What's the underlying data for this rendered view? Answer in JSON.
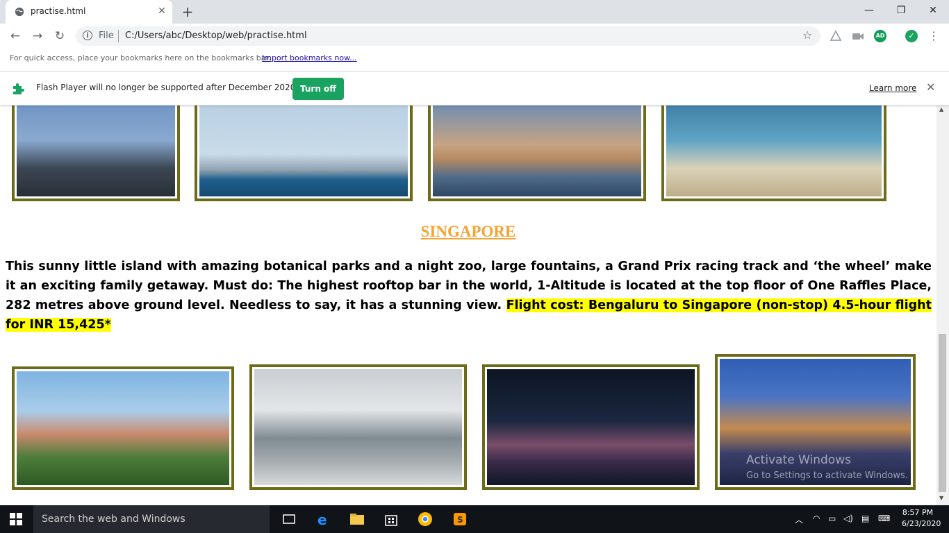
{
  "browser": {
    "tab_title": "practise.html",
    "file_label": "File",
    "url": "C:/Users/abc/Desktop/web/practise.html",
    "avatar_initials": "AD"
  },
  "bookmarks_bar": {
    "message": "For quick access, place your bookmarks here on the bookmarks bar.",
    "import_link": "Import bookmarks now..."
  },
  "infobar": {
    "message": "Flash Player will no longer be supported after December 2020.",
    "turn_off": "Turn off",
    "learn_more": "Learn more"
  },
  "page": {
    "heading": "SINGAPORE",
    "paragraph_text": "This sunny little island with amazing botanical parks and a night zoo, large fountains, a Grand Prix racing track and ‘the wheel’ make it an exciting family getaway. Must do: The highest rooftop bar in the world, 1-Altitude is located at the top floor of One Raffles Place, 282 metres above ground level. Needless to say, it has a stunning view. ",
    "paragraph_highlight": "Flight cost: Bengaluru to Singapore (non-stop) 4.5-hour flight for INR 15,425*"
  },
  "watermark": {
    "title": "Activate Windows",
    "subtitle": "Go to Settings to activate Windows."
  },
  "taskbar": {
    "search_placeholder": "Search the web and Windows",
    "time": "8:57 PM",
    "date": "6/23/2020"
  },
  "colors": {
    "frame_border": "#6b6b1a",
    "heading": "#f7a233",
    "highlight": "#ffff00",
    "turn_off_button": "#1aa260"
  }
}
